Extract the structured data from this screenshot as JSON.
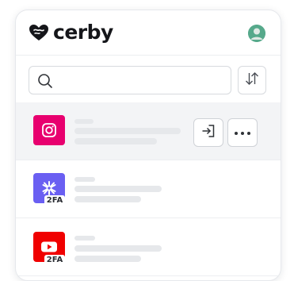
{
  "brand": {
    "name": "cerby",
    "logo_icon": "heart-icon"
  },
  "header": {
    "avatar_icon": "user-avatar-icon",
    "avatar_color": "#56a98b"
  },
  "search": {
    "placeholder": "",
    "value": "",
    "icon": "search-icon"
  },
  "toolbar": {
    "sort_icon": "sort-arrows-icon"
  },
  "accounts": [
    {
      "app": "instagram",
      "icon": "instagram-icon",
      "color": "#e8006f",
      "badge": "",
      "selected": true,
      "actions": [
        "sign-in-icon",
        "more-icon"
      ]
    },
    {
      "app": "authenticator",
      "icon": "asterisk-icon",
      "color": "#6a5ff2",
      "badge": "2FA",
      "selected": false
    },
    {
      "app": "youtube",
      "icon": "youtube-icon",
      "color": "#f00000",
      "badge": "2FA",
      "selected": false
    }
  ],
  "colors": {
    "selected_row": "#f3f4f6",
    "skeleton": "#e6e8eb",
    "border": "#d7dade"
  }
}
